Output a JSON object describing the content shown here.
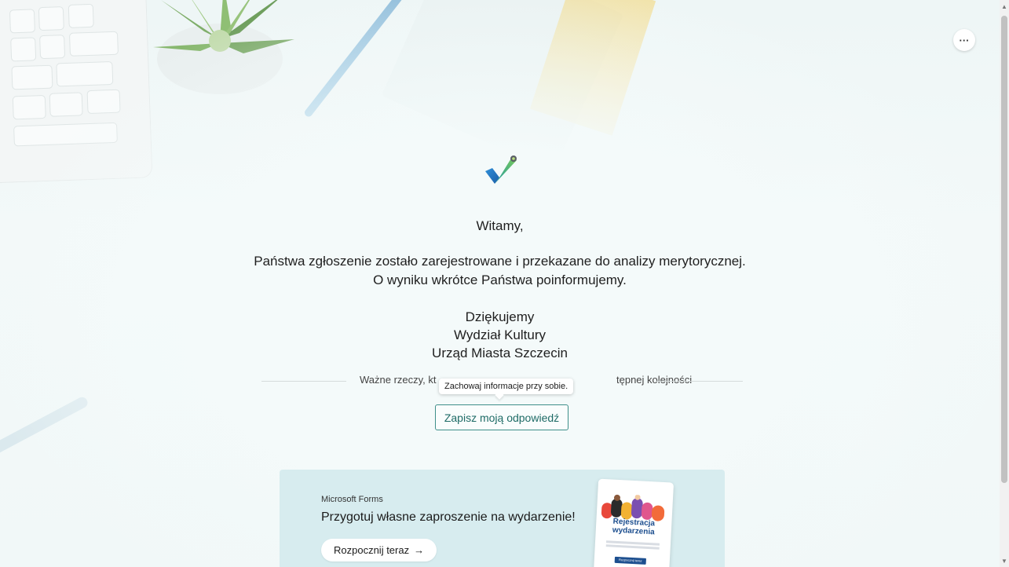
{
  "header": {
    "more_label": "···"
  },
  "message": {
    "greeting": "Witamy,",
    "line1": "Państwa zgłoszenie zostało zarejestrowane i przekazane do analizy merytorycznej.",
    "line2": "O wyniku wkrótce Państwa poinformujemy.",
    "thanks": "Dziękujemy",
    "department": "Wydział Kultury",
    "office": "Urząd Miasta Szczecin"
  },
  "divider": {
    "text_left": "Ważne rzeczy, kt",
    "text_right": "tępnej kolejności"
  },
  "tooltip": {
    "text": "Zachowaj informacje przy sobie."
  },
  "save_button": {
    "label": "Zapisz moją odpowiedź"
  },
  "promo": {
    "brand": "Microsoft Forms",
    "title": "Przygotuj własne zaproszenie na wydarzenie!",
    "button_label": "Rozpocznij teraz",
    "card_title": "Rejestracja wydarzenia",
    "card_button": "Rozpocznij teraz"
  },
  "icons": [
    "checkmark-icon",
    "more-options-icon",
    "arrow-right-icon"
  ],
  "colors": {
    "accent": "#3f8f8a",
    "promo_bg": "#d7ecef",
    "card_blue": "#1d4f8f"
  }
}
